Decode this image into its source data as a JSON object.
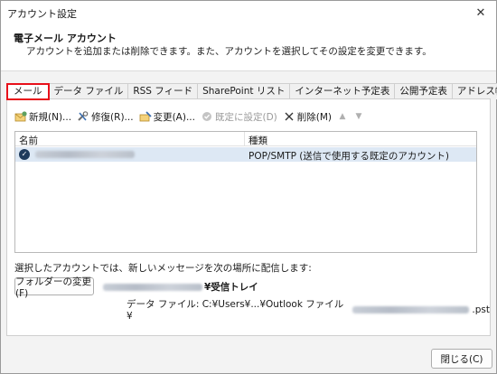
{
  "window": {
    "title": "アカウント設定"
  },
  "header": {
    "title": "電子メール アカウント",
    "description": "アカウントを追加または削除できます。また、アカウントを選択してその設定を変更できます。"
  },
  "tabs": [
    {
      "label": "メール",
      "active": true
    },
    {
      "label": "データ ファイル"
    },
    {
      "label": "RSS フィード"
    },
    {
      "label": "SharePoint リスト"
    },
    {
      "label": "インターネット予定表"
    },
    {
      "label": "公開予定表"
    },
    {
      "label": "アドレス帳"
    }
  ],
  "toolbar": {
    "new_label": "新規(N)...",
    "repair_label": "修復(R)...",
    "change_label": "変更(A)...",
    "set_default_label": "既定に設定(D)",
    "remove_label": "削除(M)"
  },
  "list": {
    "col_name": "名前",
    "col_type": "種類",
    "rows": [
      {
        "type": "POP/SMTP (送信で使用する既定のアカウント)"
      }
    ]
  },
  "delivery": {
    "label": "選択したアカウントでは、新しいメッセージを次の場所に配信します:",
    "change_folder_label": "フォルダーの変更(F)",
    "folder_suffix": "¥受信トレイ",
    "datafile_prefix": "データ ファイル: C:¥Users¥...¥Outlook ファイル¥",
    "datafile_suffix": ".pst"
  },
  "footer": {
    "close_label": "閉じる(C)"
  },
  "colors": {
    "highlight_tab_border": "#e8101a",
    "selected_row": "#dde8f4"
  }
}
